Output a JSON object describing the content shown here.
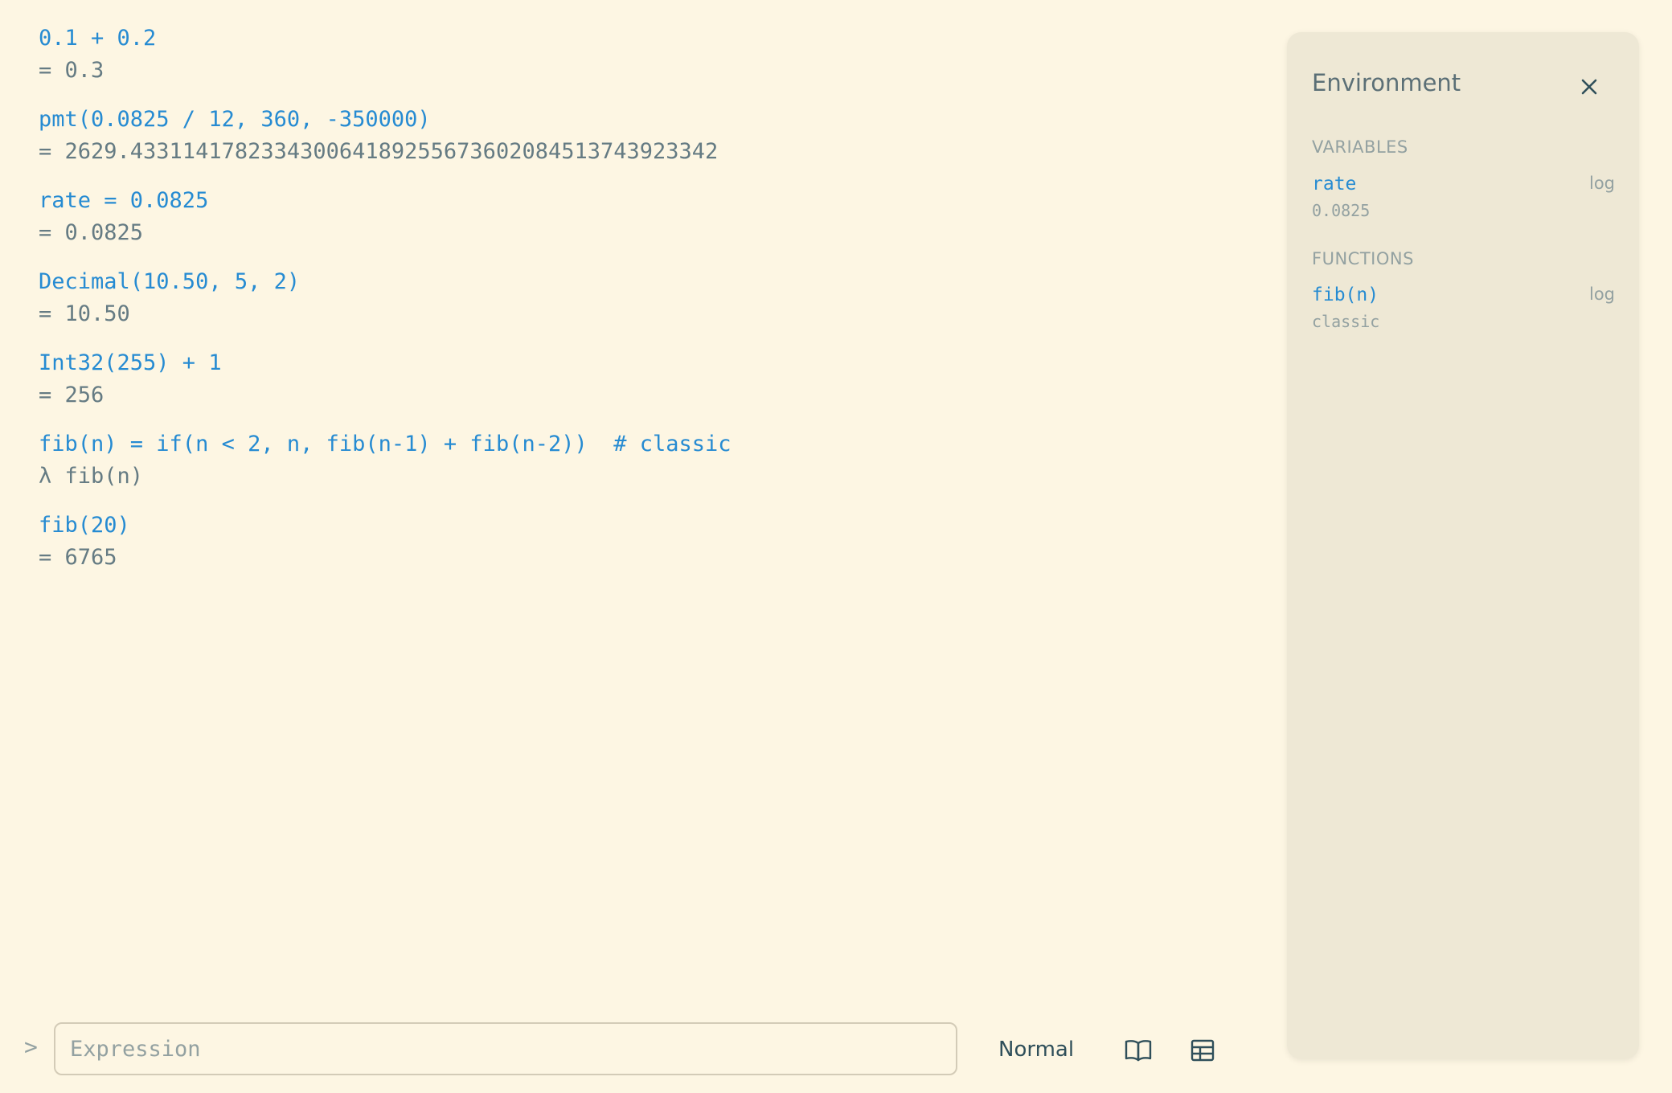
{
  "history": [
    {
      "input": "0.1 + 0.2",
      "output": "= 0.3"
    },
    {
      "input": "pmt(0.0825 / 12, 360, -350000)",
      "output": "= 2629.433114178233430064189255673602084513743923342"
    },
    {
      "input": "rate = 0.0825",
      "output": "= 0.0825"
    },
    {
      "input": "Decimal(10.50, 5, 2)",
      "output": "= 10.50"
    },
    {
      "input": "Int32(255) + 1",
      "output": "= 256"
    },
    {
      "input": "fib(n) = if(n < 2, n, fib(n-1) + fib(n-2))  # classic",
      "output": "λ fib(n)"
    },
    {
      "input": "fib(20)",
      "output": "= 6765"
    }
  ],
  "command_bar": {
    "prompt": ">",
    "placeholder": "Expression",
    "mode_label": "Normal",
    "reference_icon": "open-book-icon",
    "table_icon": "table-grid-icon"
  },
  "environment": {
    "title": "Environment",
    "close_icon": "close-icon",
    "variables_heading": "VARIABLES",
    "variables": [
      {
        "name": "rate",
        "value": "0.0825",
        "action": "log"
      }
    ],
    "functions_heading": "FUNCTIONS",
    "functions": [
      {
        "name": "fib(n)",
        "value": "classic",
        "action": "log"
      }
    ]
  },
  "colors": {
    "background": "#fdf6e3",
    "panel": "#eee8d5",
    "input_text": "#268bd2",
    "output_text": "#657b83"
  }
}
